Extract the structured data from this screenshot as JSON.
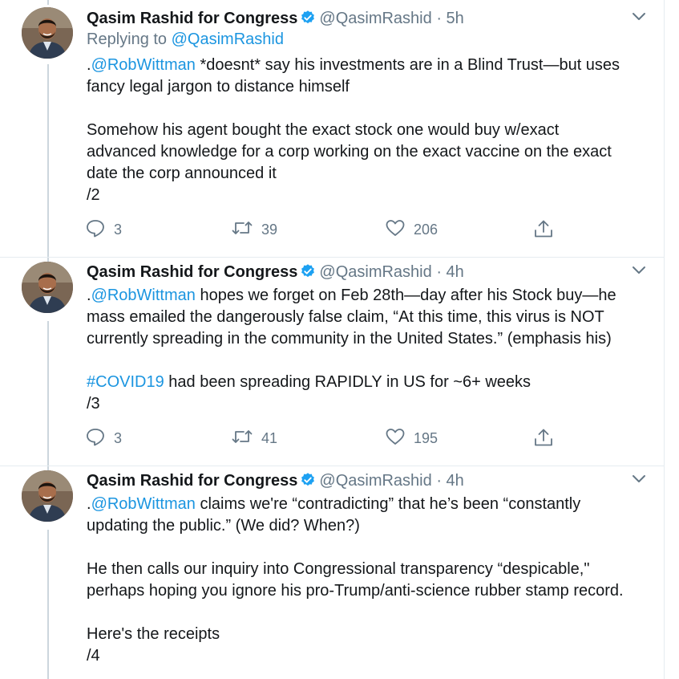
{
  "tweets": [
    {
      "name": "Qasim Rashid for Congress",
      "handle": "@QasimRashid",
      "dot": "·",
      "time": "5h",
      "replying_prefix": "Replying to ",
      "replying_handle": "@QasimRashid",
      "lines": [
        {
          "prefix": ".",
          "link": "@RobWittman",
          "text": " *doesnt* say his investments are in a Blind Trust—but uses"
        },
        {
          "text": "fancy legal jargon to distance himself"
        },
        {
          "gap": true
        },
        {
          "text": "Somehow his agent bought the exact stock one would buy w/exact"
        },
        {
          "text": "advanced knowledge for a corp working on the exact vaccine on the exact"
        },
        {
          "text": "date the corp announced it"
        },
        {
          "text": "/2"
        }
      ],
      "replies": "3",
      "retweets": "39",
      "likes": "206"
    },
    {
      "name": "Qasim Rashid for Congress",
      "handle": "@QasimRashid",
      "dot": "·",
      "time": "4h",
      "lines": [
        {
          "prefix": ".",
          "link": "@RobWittman",
          "text": " hopes we forget on Feb 28th—day after his Stock buy—he"
        },
        {
          "text": "mass emailed the dangerously false claim, “At this time, this virus is NOT"
        },
        {
          "text": "currently spreading in the community in the United States.” (emphasis his)"
        },
        {
          "gap": true
        },
        {
          "link": "#COVID19",
          "text": " had been spreading RAPIDLY in US for ~6+ weeks"
        },
        {
          "text": "/3"
        }
      ],
      "replies": "3",
      "retweets": "41",
      "likes": "195"
    },
    {
      "name": "Qasim Rashid for Congress",
      "handle": "@QasimRashid",
      "dot": "·",
      "time": "4h",
      "lines": [
        {
          "prefix": ".",
          "link": "@RobWittman",
          "text": " claims we're “contradicting” that he’s been “constantly"
        },
        {
          "text": "updating the public.” (We did? When?)"
        },
        {
          "gap": true
        },
        {
          "text": "He then calls our inquiry into Congressional transparency “despicable,\""
        },
        {
          "text": "perhaps hoping you ignore his pro-Trump/anti-science rubber stamp record."
        },
        {
          "gap": true
        },
        {
          "text": "Here's the receipts"
        },
        {
          "text": "/4"
        }
      ]
    }
  ],
  "icons": [
    "verified-badge-icon",
    "chevron-down-icon",
    "reply-icon",
    "retweet-icon",
    "like-icon",
    "share-icon"
  ],
  "colors": {
    "link": "#1b95e0",
    "secondary": "#657786",
    "divider": "#e6ecf0",
    "thread_line": "#ccd6dd",
    "verified": "#1da1f2"
  }
}
